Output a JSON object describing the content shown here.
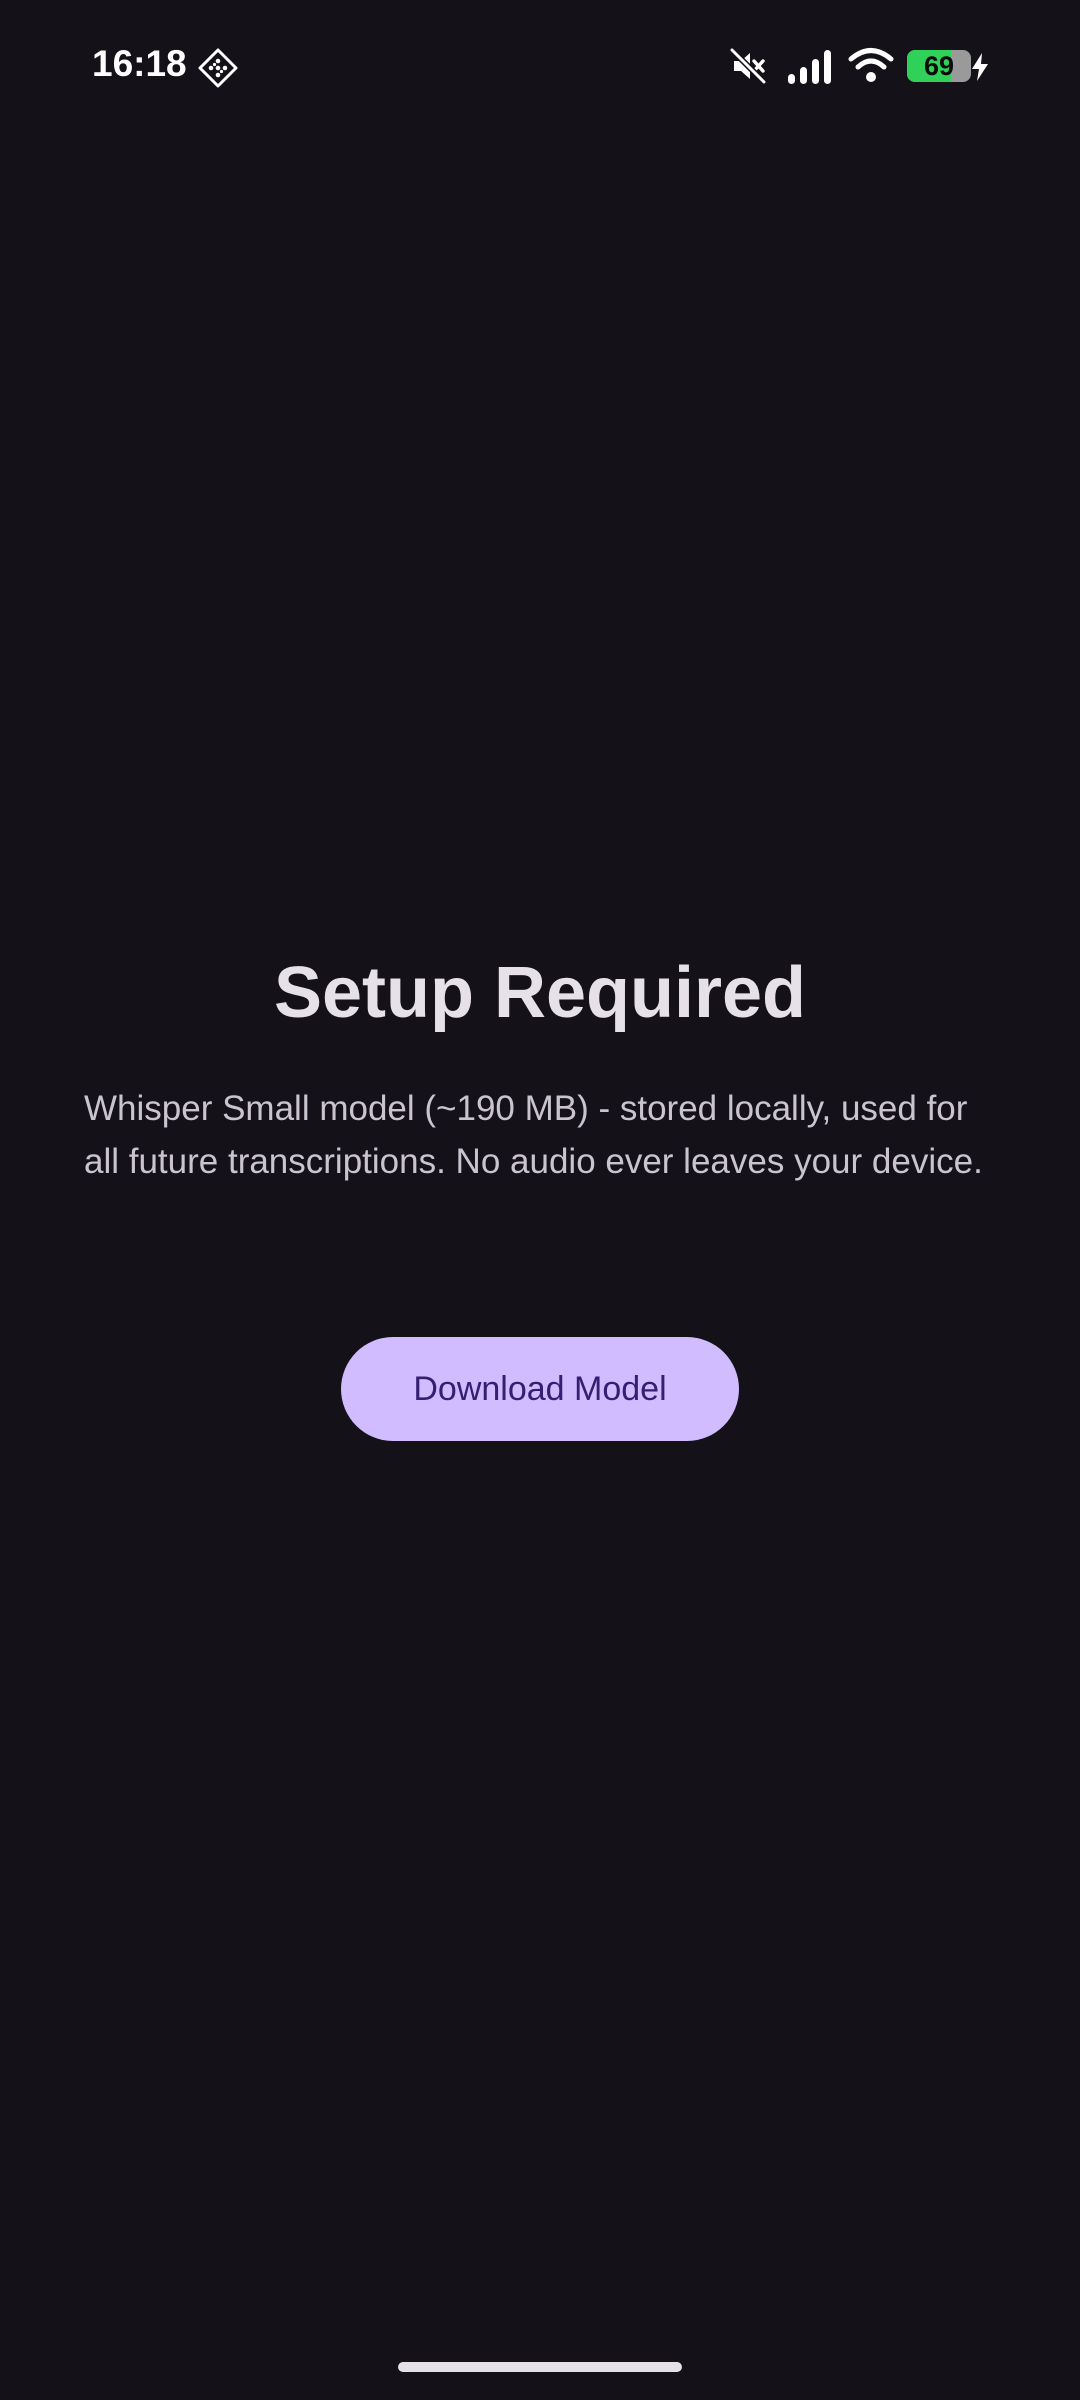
{
  "status_bar": {
    "time": "16:18",
    "app_icon": "diamond-grid-icon",
    "icons": [
      "mute-icon",
      "signal-icon",
      "wifi-icon",
      "battery-icon",
      "charging-icon"
    ],
    "battery_level": "69",
    "battery_fraction": 0.69
  },
  "main": {
    "title": "Setup Required",
    "description": "Whisper Small model (~190 MB) - stored locally, used for all future transcriptions. No audio ever leaves your device.",
    "download_button_label": "Download Model"
  },
  "colors": {
    "background": "#141218",
    "title": "#e6e0e9",
    "description": "#cac4d0",
    "button_background": "#d0bcff",
    "button_text": "#381e72",
    "battery_fill": "#2fd158"
  }
}
